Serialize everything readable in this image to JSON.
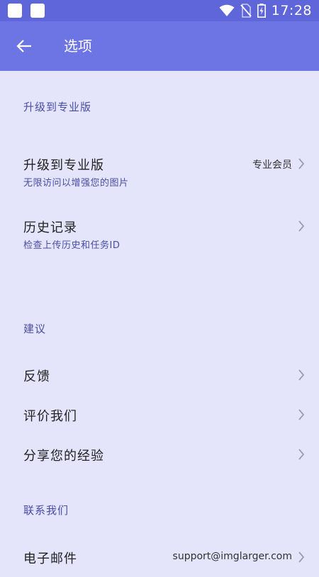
{
  "status_bar": {
    "time": "17:28",
    "icons": [
      "app-square-icon",
      "app-square-icon",
      "wifi-icon",
      "no-sim-icon",
      "battery-charging-icon"
    ]
  },
  "app_bar": {
    "back_icon": "arrow-left-icon",
    "title": "选项"
  },
  "sections": {
    "upgrade": {
      "header": "升级到专业版",
      "items": [
        {
          "title": "升级到专业版",
          "subtitle": "无限访问以增强您的图片",
          "value": "专业会员"
        },
        {
          "title": "历史记录",
          "subtitle": "检查上传历史和任务ID"
        }
      ]
    },
    "suggestions": {
      "header": "建议",
      "items": [
        {
          "title": "反馈"
        },
        {
          "title": "评价我们"
        },
        {
          "title": "分享您的经验"
        }
      ]
    },
    "contact": {
      "header": "联系我们",
      "items": [
        {
          "title": "电子邮件",
          "value": "support@imglarger.com"
        }
      ]
    }
  },
  "colors": {
    "status_bar": "#5f66d9",
    "app_bar": "#6d74e3",
    "background": "#e4e4fb",
    "accent_text": "#4a4da6"
  }
}
